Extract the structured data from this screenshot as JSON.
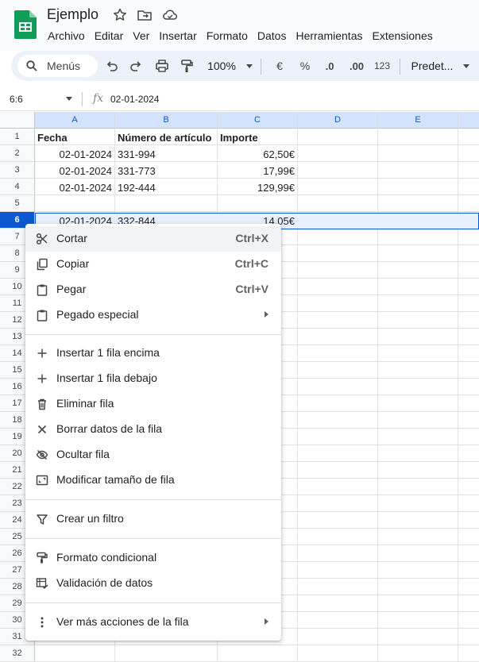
{
  "app": {
    "title": "Ejemplo",
    "brand_color": "#0f9d58"
  },
  "menu": [
    "Archivo",
    "Editar",
    "Ver",
    "Insertar",
    "Formato",
    "Datos",
    "Herramientas",
    "Extensiones"
  ],
  "toolbar": {
    "search": "Menús",
    "zoom": "100%",
    "currency": "€",
    "percent": "%",
    "dec_less": ".0",
    "dec_more": ".00",
    "num_format": "123",
    "font": "Predet..."
  },
  "formula": {
    "name_box": "6:6",
    "fx": "fx",
    "value": "02-01-2024"
  },
  "columns": [
    "A",
    "B",
    "C",
    "D",
    "E"
  ],
  "rows": [
    "1",
    "2",
    "3",
    "4",
    "5",
    "6",
    "7",
    "8",
    "9",
    "10",
    "11",
    "12",
    "13",
    "14",
    "15",
    "16",
    "17",
    "18",
    "19",
    "20",
    "21",
    "22",
    "23",
    "24",
    "25",
    "26",
    "27",
    "28",
    "29",
    "30",
    "31",
    "32"
  ],
  "cells": {
    "a1": "Fecha",
    "b1": "Número de artículo",
    "c1": "Importe",
    "a2": "02-01-2024",
    "b2": "331-994",
    "c2": "62,50€",
    "a3": "02-01-2024",
    "b3": "331-773",
    "c3": "17,99€",
    "a4": "02-01-2024",
    "b4": "192-444",
    "c4": "129,99€",
    "a6": "02-01-2024",
    "b6": "332-844",
    "c6": "14,05€"
  },
  "context_menu": {
    "cut": {
      "label": "Cortar",
      "shortcut": "Ctrl+X"
    },
    "copy": {
      "label": "Copiar",
      "shortcut": "Ctrl+C"
    },
    "paste": {
      "label": "Pegar",
      "shortcut": "Ctrl+V"
    },
    "paste_special": {
      "label": "Pegado especial"
    },
    "insert_above": {
      "label": "Insertar 1 fila encima"
    },
    "insert_below": {
      "label": "Insertar 1 fila debajo"
    },
    "delete_row": {
      "label": "Eliminar fila"
    },
    "clear_row": {
      "label": "Borrar datos de la fila"
    },
    "hide_row": {
      "label": "Ocultar fila"
    },
    "resize_row": {
      "label": "Modificar tamaño de fila"
    },
    "filter": {
      "label": "Crear un filtro"
    },
    "cond_format": {
      "label": "Formato condicional"
    },
    "validation": {
      "label": "Validación de datos"
    },
    "more": {
      "label": "Ver más acciones de la fila"
    }
  }
}
